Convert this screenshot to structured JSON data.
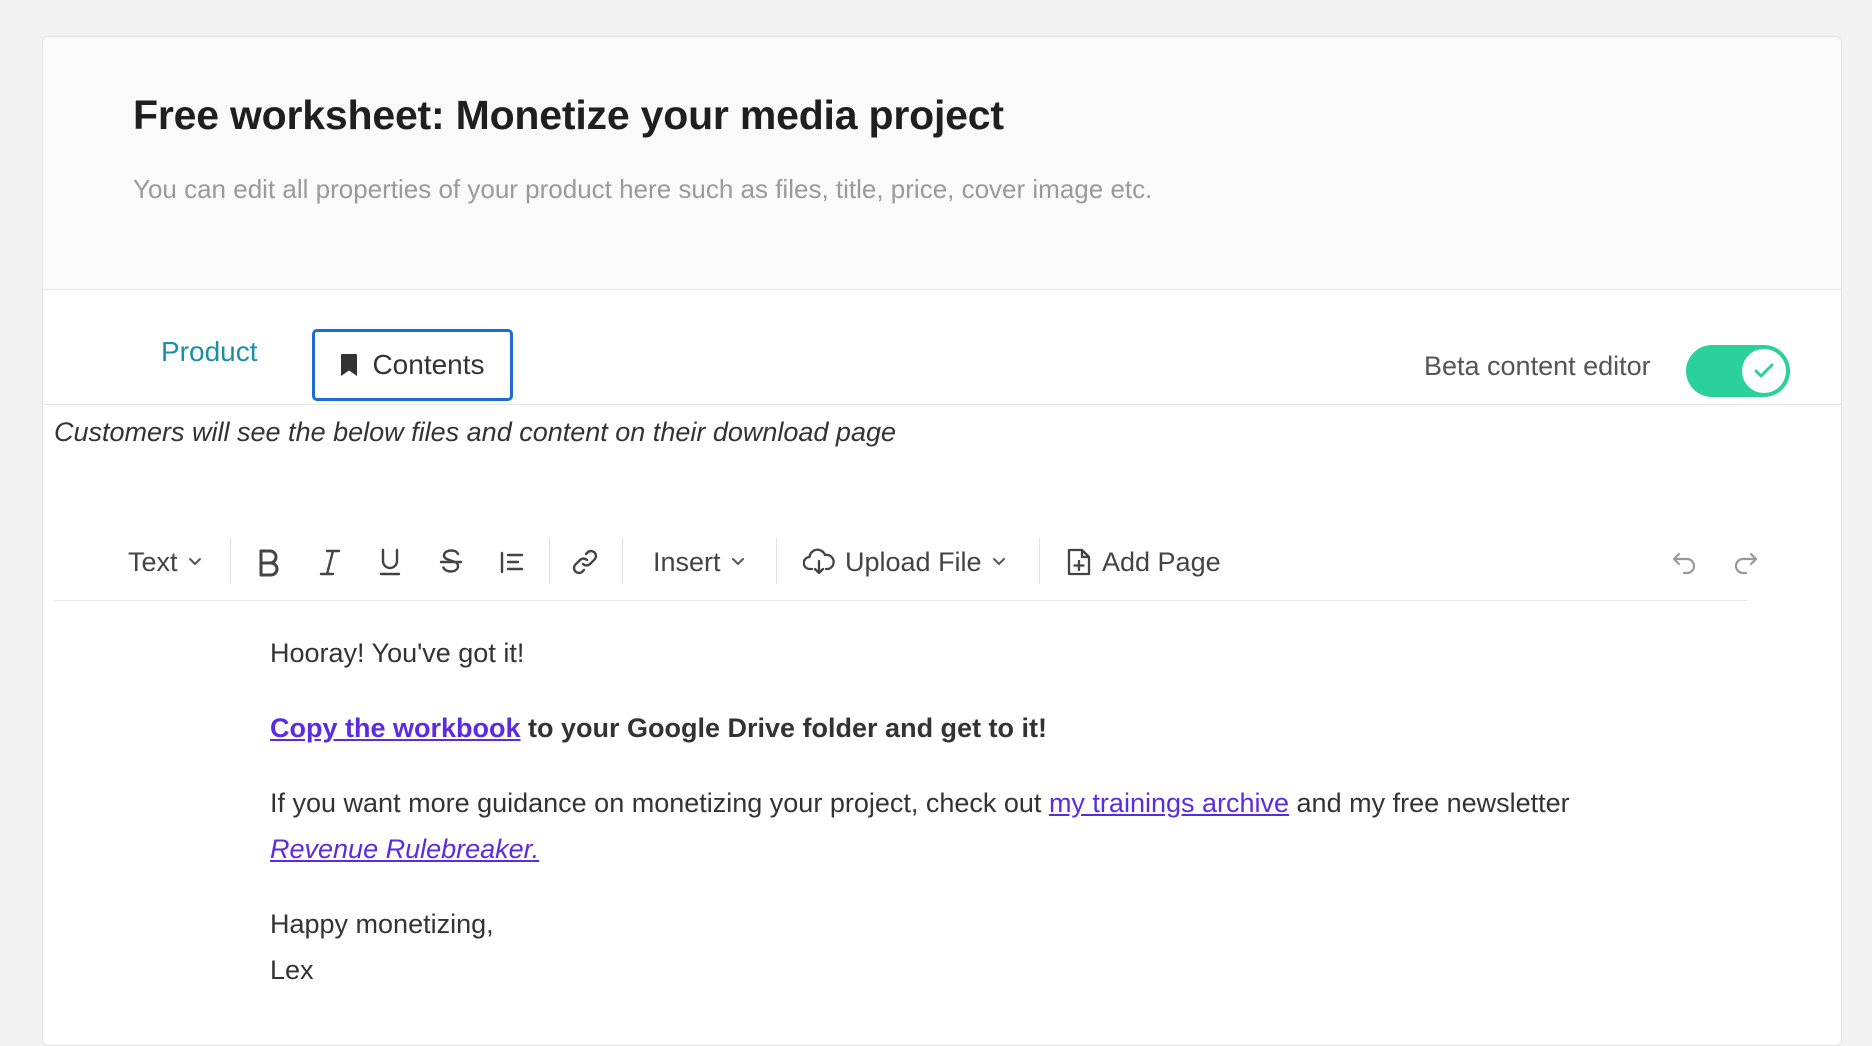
{
  "header": {
    "title": "Free worksheet: Monetize your media project",
    "subtitle": "You can edit all properties of your product here such as files, title, price, cover image etc."
  },
  "tabs": {
    "product": "Product",
    "contents": "Contents"
  },
  "beta": {
    "label": "Beta content editor",
    "enabled": true,
    "toggle_color": "#2bd19a"
  },
  "notice": "Customers will see the below files and content on their download page",
  "toolbar": {
    "text_style": "Text",
    "insert": "Insert",
    "upload_file": "Upload File",
    "add_page": "Add Page"
  },
  "content": {
    "greeting": "Hooray! You've got it!",
    "workbook_link": "Copy the workbook",
    "workbook_rest": " to your Google Drive folder and get to it!",
    "guidance_pre": "If you want more guidance on monetizing your project, check out ",
    "trainings_link": "my trainings archive",
    "guidance_mid": " and my free newsletter ",
    "newsletter_link": "Revenue Rulebreaker.",
    "signoff": "Happy monetizing,",
    "signature": "Lex"
  },
  "colors": {
    "accent_tab": "#1a8fa8",
    "focus_border": "#1e6bd6",
    "link": "#5a2be3"
  }
}
